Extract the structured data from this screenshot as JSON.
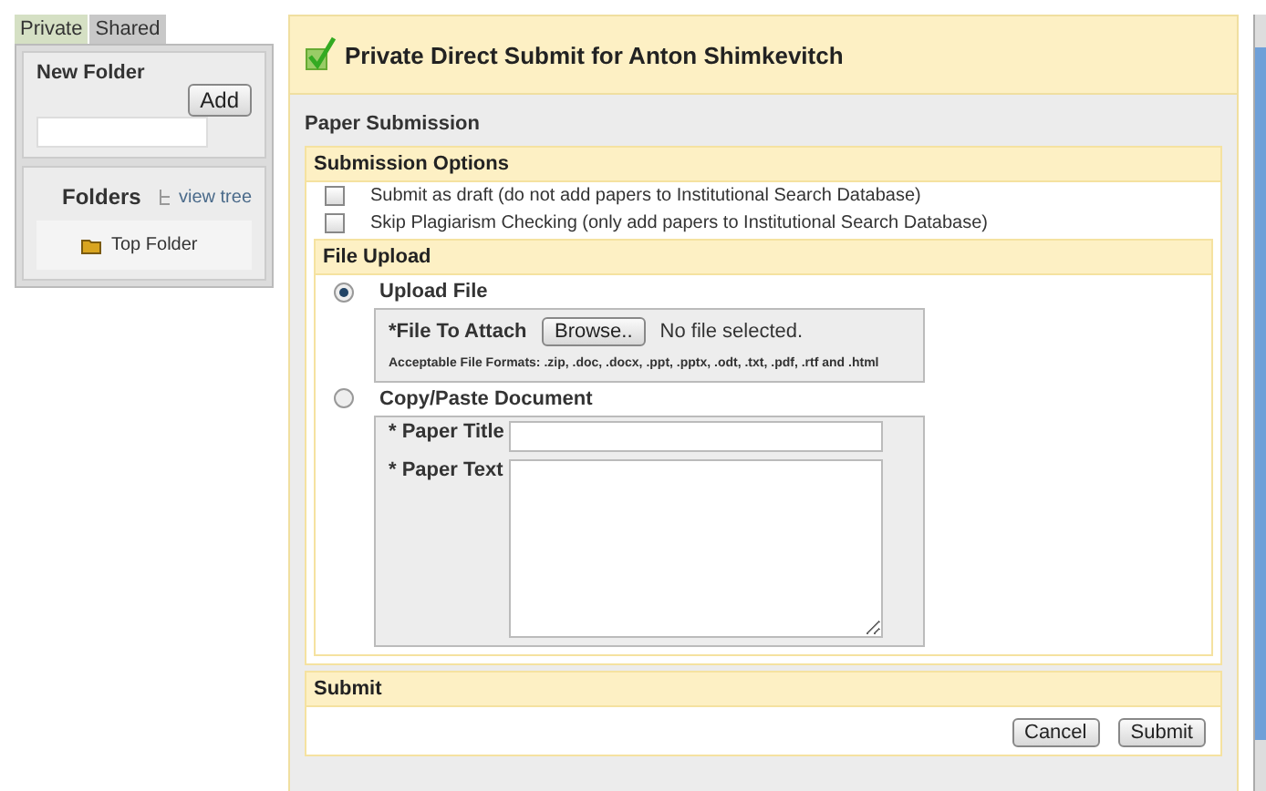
{
  "sidebar": {
    "tabs": [
      {
        "label": "Private",
        "selected": true
      },
      {
        "label": "Shared",
        "selected": false
      }
    ],
    "new_folder": {
      "label": "New Folder",
      "button": "Add"
    },
    "folders": {
      "title": "Folders",
      "link": "view tree",
      "items": [
        {
          "label": "Top Folder"
        }
      ]
    }
  },
  "main": {
    "title": "Private Direct Submit for Anton Shimkevitch",
    "subtitle": "Paper Submission",
    "options": {
      "title": "Submission Options",
      "items": [
        {
          "label": "Submit as draft (do not add papers to Institutional Search Database)",
          "checked": false
        },
        {
          "label": "Skip Plagiarism Checking (only add papers to Institutional Search Database)",
          "checked": false
        }
      ]
    },
    "upload": {
      "title": "File Upload",
      "methods": [
        {
          "kind": "file",
          "label": "Upload File",
          "selected": true,
          "field_label": "*File To Attach",
          "button": "Browse..",
          "status": "No file selected.",
          "note": "Acceptable File Formats: .zip, .doc, .docx, .ppt, .pptx, .odt, .txt, .pdf, .rtf and .html"
        },
        {
          "kind": "paste",
          "label": "Copy/Paste Document",
          "selected": false,
          "title_label": "* Paper Title",
          "text_label": "* Paper Text"
        }
      ]
    },
    "submit": {
      "title": "Submit",
      "buttons": [
        "Cancel",
        "Submit"
      ]
    }
  }
}
